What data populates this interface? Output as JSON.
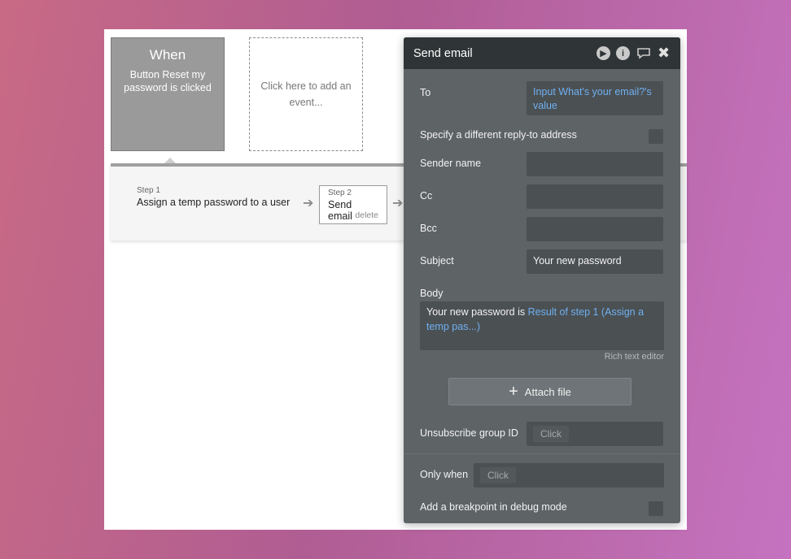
{
  "event": {
    "title": "When",
    "description": "Button Reset my password is clicked"
  },
  "add_event_label": "Click here to add an event...",
  "steps": [
    {
      "step_label": "Step 1",
      "title": "Assign a temp password to a user"
    },
    {
      "step_label": "Step 2",
      "title": "Send email",
      "delete_label": "delete"
    }
  ],
  "panel": {
    "title": "Send email",
    "icons": [
      "play-icon",
      "info-icon",
      "comment-icon",
      "close-icon"
    ],
    "to": {
      "label": "To",
      "value": "Input What's your email?'s value"
    },
    "reply_to_label": "Specify a different reply-to address",
    "sender_name_label": "Sender name",
    "cc_label": "Cc",
    "bcc_label": "Bcc",
    "subject": {
      "label": "Subject",
      "value": "Your new password"
    },
    "body": {
      "label": "Body",
      "static_text": "Your new password is ",
      "dynamic_text": "Result of step 1 (Assign a temp pas...)"
    },
    "rich_text_editor_label": "Rich text editor",
    "attach_file_label": "Attach file",
    "unsubscribe": {
      "label": "Unsubscribe group ID",
      "placeholder": "Click"
    },
    "only_when": {
      "label": "Only when",
      "placeholder": "Click"
    },
    "breakpoint_label": "Add a breakpoint in debug mode"
  },
  "colors": {
    "panel_bg": "#5e6366",
    "panel_header": "#2f3436",
    "dynamic_text": "#6fb0f0",
    "event_card": "#9a9a9a"
  }
}
